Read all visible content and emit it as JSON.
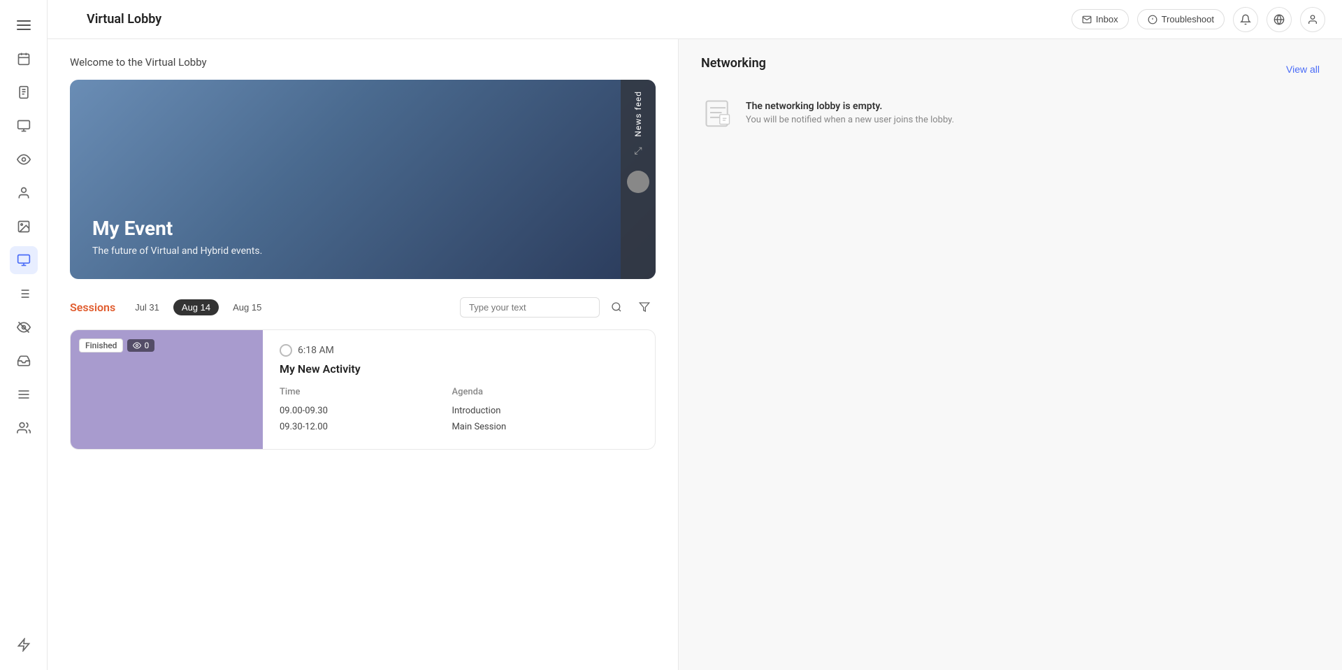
{
  "app": {
    "title": "Virtual Lobby"
  },
  "topbar": {
    "inbox_label": "Inbox",
    "troubleshoot_label": "Troubleshoot",
    "view_all_label": "View all"
  },
  "sidebar": {
    "items": [
      {
        "name": "menu",
        "icon": "☰"
      },
      {
        "name": "calendar",
        "icon": "📅"
      },
      {
        "name": "clipboard",
        "icon": "📋"
      },
      {
        "name": "monitor",
        "icon": "🖥"
      },
      {
        "name": "eye-alt",
        "icon": "👁"
      },
      {
        "name": "person",
        "icon": "👤"
      },
      {
        "name": "image",
        "icon": "🖼"
      },
      {
        "name": "screen",
        "icon": "📺"
      },
      {
        "name": "list-view",
        "icon": "📄"
      },
      {
        "name": "eye-dash",
        "icon": "👁"
      },
      {
        "name": "inbox-tray",
        "icon": "📥"
      },
      {
        "name": "lines",
        "icon": "☰"
      },
      {
        "name": "group",
        "icon": "👥"
      }
    ],
    "bottom_icon": "⚡"
  },
  "welcome": {
    "text": "Welcome to the Virtual Lobby"
  },
  "hero": {
    "event_name": "My Event",
    "event_tagline": "The future of Virtual and Hybrid events.",
    "news_feed_label": "News feed"
  },
  "sessions": {
    "title": "Sessions",
    "dates": [
      {
        "label": "Jul 31",
        "active": false
      },
      {
        "label": "Aug 14",
        "active": true
      },
      {
        "label": "Aug 15",
        "active": false
      }
    ],
    "search_placeholder": "Type your text",
    "card": {
      "badge_finished": "Finished",
      "badge_views": "0",
      "time": "6:18 AM",
      "name": "My New Activity",
      "agenda_headers": [
        "Time",
        "Agenda"
      ],
      "agenda_rows": [
        {
          "time": "09.00-09.30",
          "topic": "Introduction"
        },
        {
          "time": "09.30-12.00",
          "topic": "Main Session"
        }
      ]
    }
  },
  "networking": {
    "title": "Networking",
    "empty_title": "The networking lobby is empty.",
    "empty_subtitle": "You will be notified when a new user joins the lobby."
  }
}
